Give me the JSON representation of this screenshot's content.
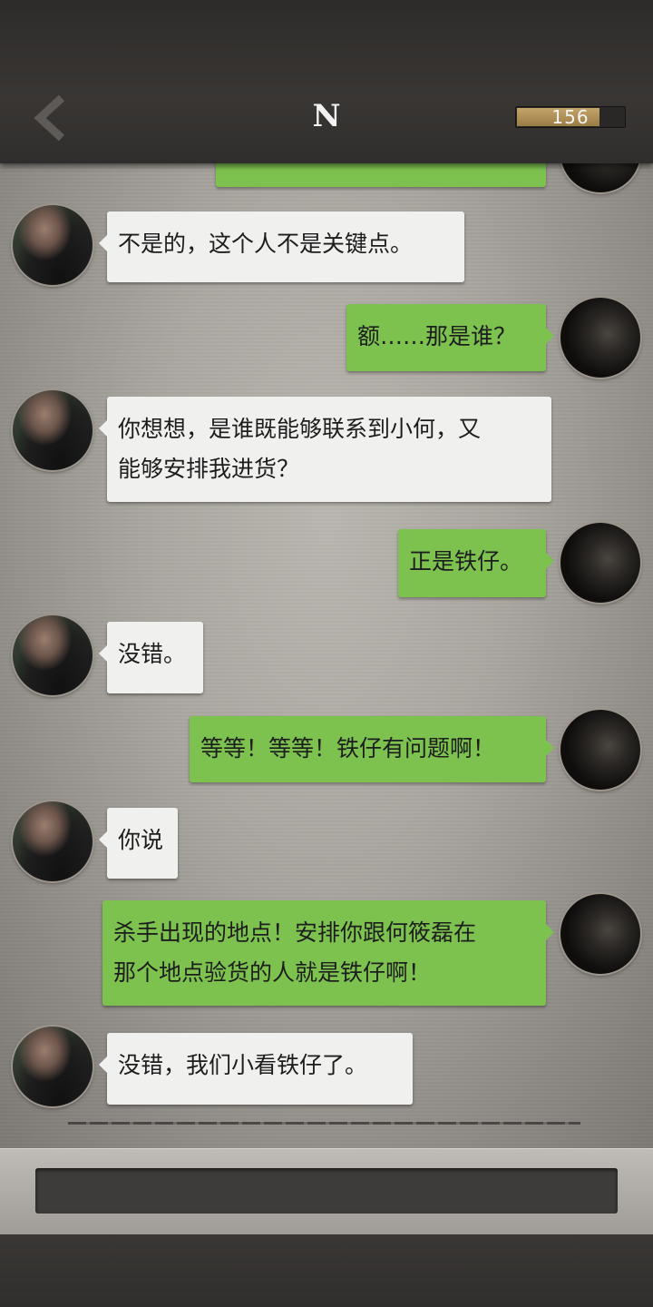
{
  "header": {
    "title": "N",
    "counter": {
      "value": "156",
      "fill_fraction": 0.77
    }
  },
  "messages": [
    {
      "side": "left",
      "lines": [
        "不是的，这个人不是关键点。"
      ]
    },
    {
      "side": "right",
      "lines": [
        "额……那是谁？"
      ]
    },
    {
      "side": "left",
      "lines": [
        "你想想，是谁既能够联系到小何，又",
        "能够安排我进货？"
      ]
    },
    {
      "side": "right",
      "lines": [
        "正是铁仔。"
      ]
    },
    {
      "side": "left",
      "lines": [
        "没错。"
      ]
    },
    {
      "side": "right",
      "lines": [
        "等等！等等！铁仔有问题啊！"
      ]
    },
    {
      "side": "left",
      "lines": [
        "你说"
      ]
    },
    {
      "side": "right",
      "lines": [
        "杀手出现的地点！安排你跟何筱磊在",
        "那个地点验货的人就是铁仔啊！"
      ]
    },
    {
      "side": "left",
      "lines": [
        "没错，我们小看铁仔了。"
      ]
    }
  ],
  "colors": {
    "incoming_bubble": "#f0f0ee",
    "outgoing_bubble": "#7dc24f",
    "counter_fill": "#b0925a"
  },
  "icons": {
    "back": "chevron-left-icon"
  }
}
